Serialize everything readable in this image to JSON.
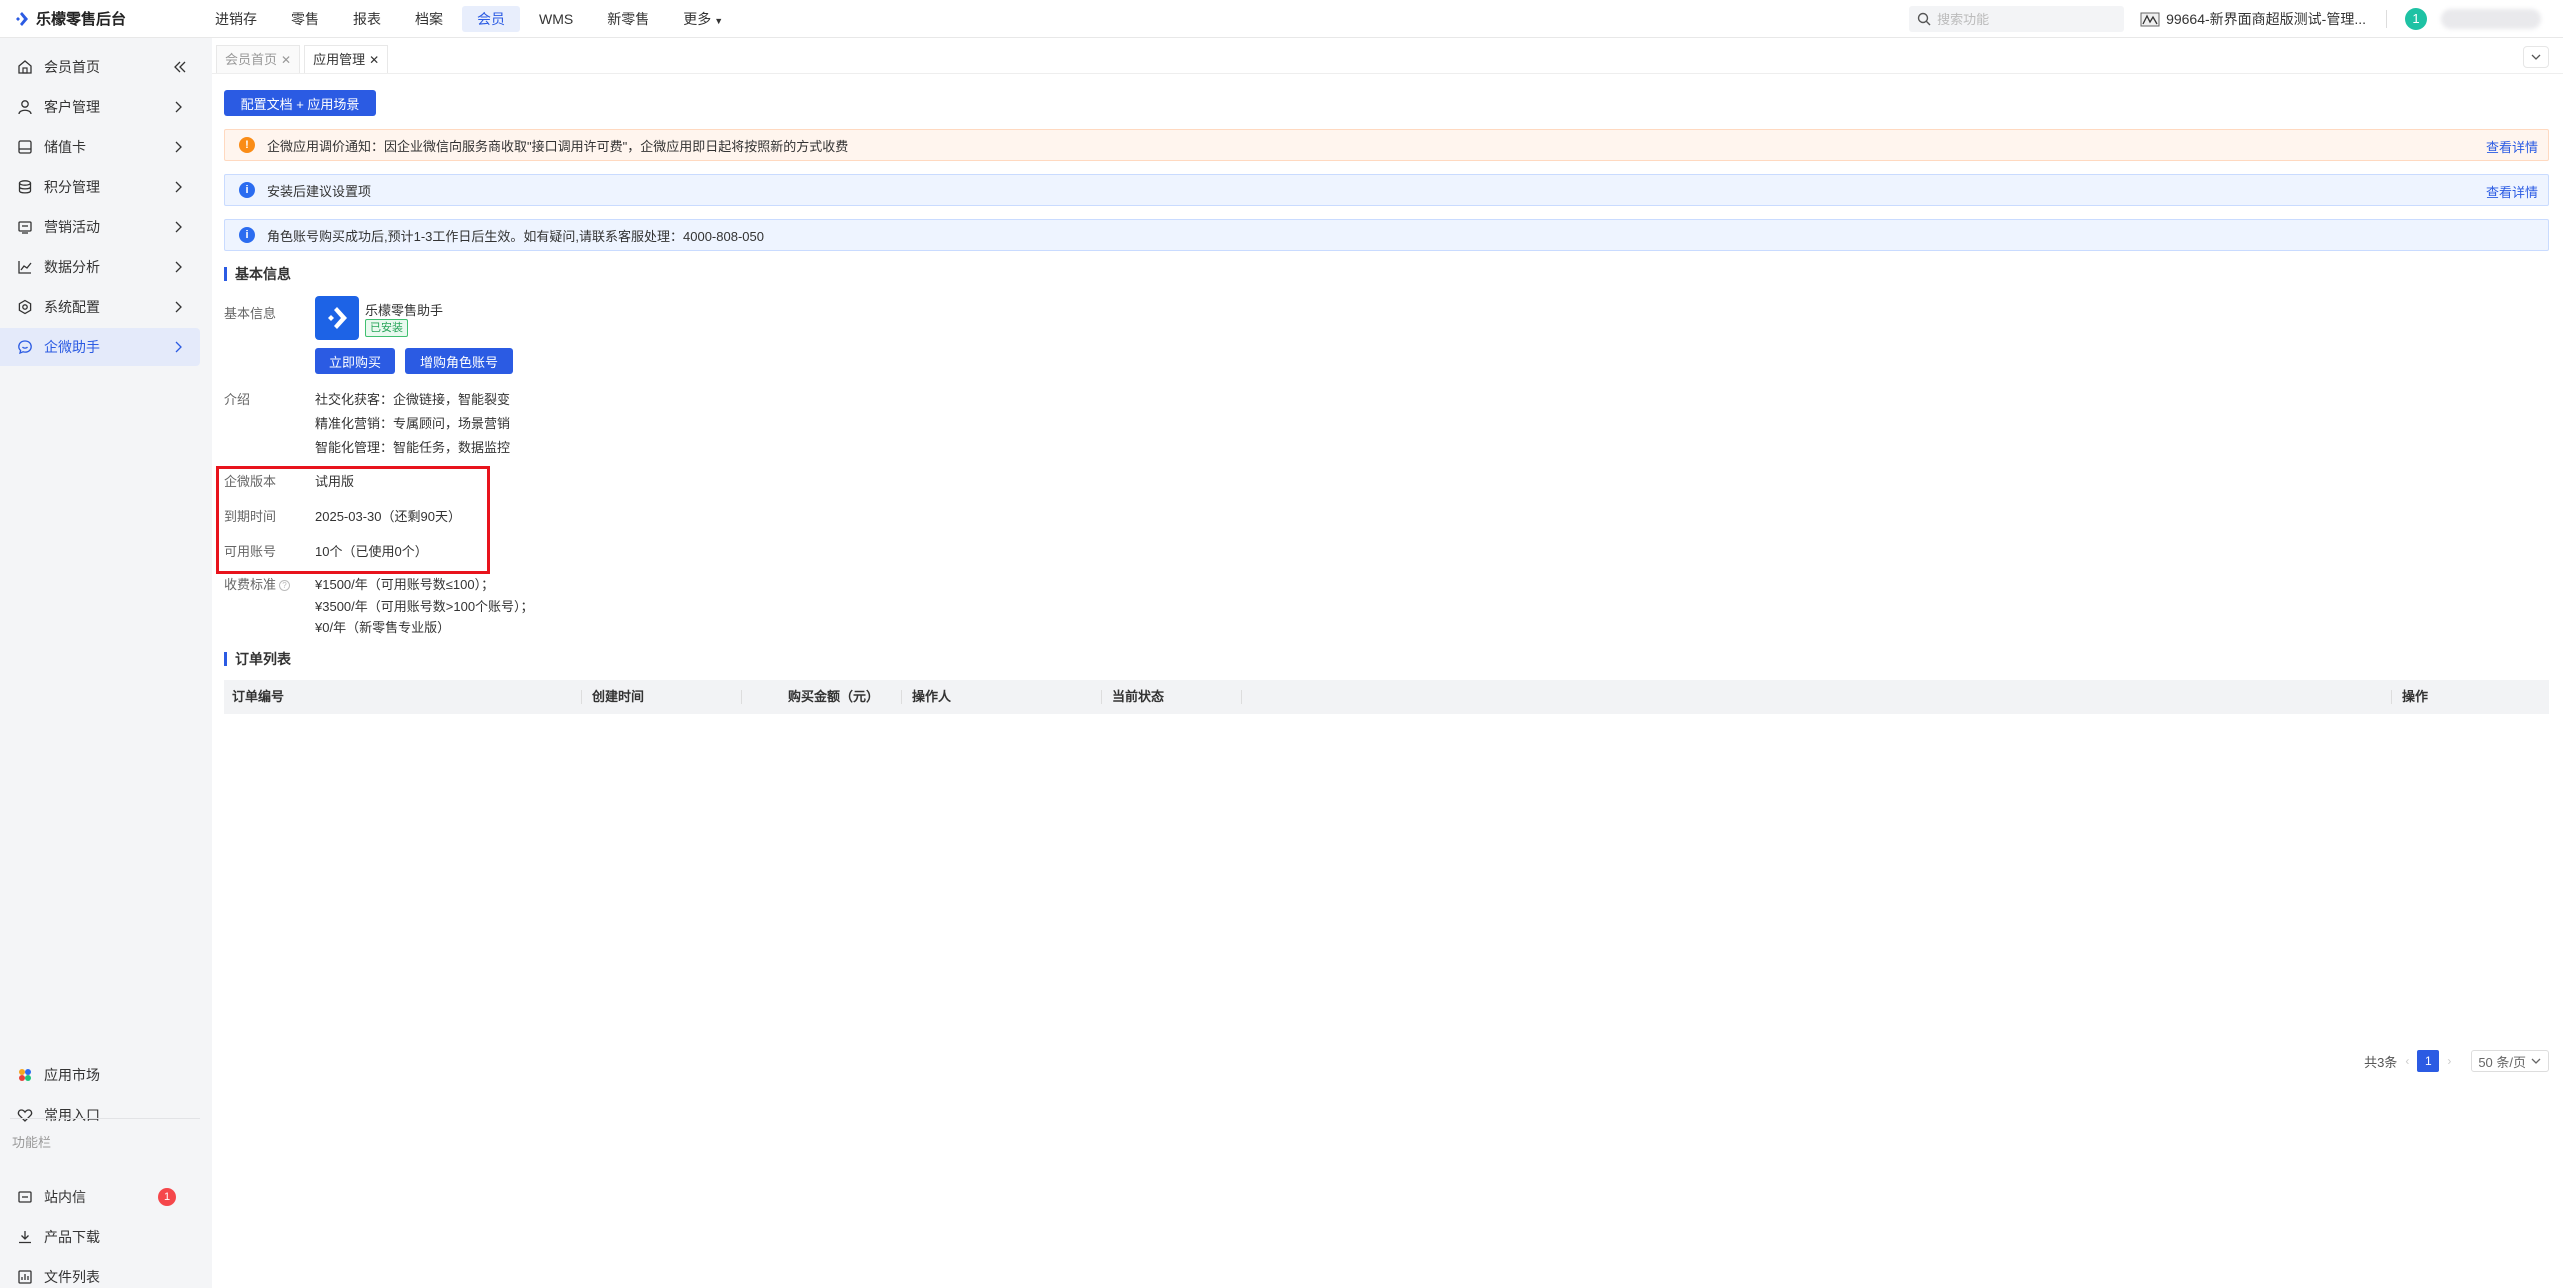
{
  "app": {
    "title": "乐檬零售后台"
  },
  "topnav": [
    {
      "label": "进销存",
      "active": false
    },
    {
      "label": "零售",
      "active": false
    },
    {
      "label": "报表",
      "active": false
    },
    {
      "label": "档案",
      "active": false
    },
    {
      "label": "会员",
      "active": true
    },
    {
      "label": "WMS",
      "active": false
    },
    {
      "label": "新零售",
      "active": false
    },
    {
      "label": "更多",
      "active": false
    }
  ],
  "header": {
    "search_placeholder": "搜索功能",
    "store_label": "99664-新界面商超版测试-管理...",
    "notification_count": "1"
  },
  "sidebar": {
    "items": [
      {
        "label": "会员首页",
        "icon": "home-icon"
      },
      {
        "label": "客户管理",
        "icon": "user-icon"
      },
      {
        "label": "储值卡",
        "icon": "card-icon"
      },
      {
        "label": "积分管理",
        "icon": "coins-icon"
      },
      {
        "label": "营销活动",
        "icon": "campaign-icon"
      },
      {
        "label": "数据分析",
        "icon": "chart-icon"
      },
      {
        "label": "系统配置",
        "icon": "settings-icon"
      },
      {
        "label": "企微助手",
        "icon": "chat-icon",
        "active": true
      }
    ],
    "bottom": {
      "app_market": "应用市场",
      "frequent": "常用入口",
      "function_bar": "功能栏",
      "messages": "站内信",
      "messages_badge": "1",
      "downloads": "产品下载",
      "files": "文件列表"
    }
  },
  "tabs": [
    {
      "label": "会员首页",
      "active": false
    },
    {
      "label": "应用管理",
      "active": true
    }
  ],
  "main": {
    "config_button": "配置文档 + 应用场景",
    "alerts": [
      {
        "type": "warn",
        "text": "企微应用调价通知：因企业微信向服务商收取\"接口调用许可费\"，企微应用即日起将按照新的方式收费",
        "link": "查看详情"
      },
      {
        "type": "info",
        "text": "安装后建议设置项",
        "link": "查看详情"
      },
      {
        "type": "info",
        "text": "角色账号购买成功后,预计1-3工作日后生效。如有疑问,请联系客服处理：4000-808-050",
        "link": ""
      }
    ],
    "basic_section_title": "基本信息",
    "basic_label": "基本信息",
    "app_name": "乐檬零售助手",
    "installed_tag": "已安装",
    "buy_now": "立即购买",
    "buy_role": "增购角色账号",
    "intro_label": "介绍",
    "intro_lines": [
      "社交化获客：企微链接，智能裂变",
      "精准化营销：专属顾问，场景营销",
      "智能化管理：智能任务，数据监控"
    ],
    "version_label": "企微版本",
    "version_value": "试用版",
    "expire_label": "到期时间",
    "expire_value": "2025-03-30（还剩90天）",
    "accounts_label": "可用账号",
    "accounts_value": "10个（已使用0个）",
    "fee_label": "收费标准",
    "fee_lines": [
      "¥1500/年（可用账号数≤100）；",
      "¥3500/年（可用账号数>100个账号）；",
      "¥0/年（新零售专业版）"
    ],
    "orders_section_title": "订单列表",
    "table_headers": [
      "订单编号",
      "创建时间",
      "购买金额（元）",
      "操作人",
      "当前状态",
      "操作"
    ],
    "pagination": {
      "total": "共3条",
      "current_page": "1",
      "page_size": "50 条/页"
    }
  },
  "colors": {
    "primary": "#2b5be3",
    "highlight": "#e8131c",
    "warn": "#fa8c16"
  }
}
